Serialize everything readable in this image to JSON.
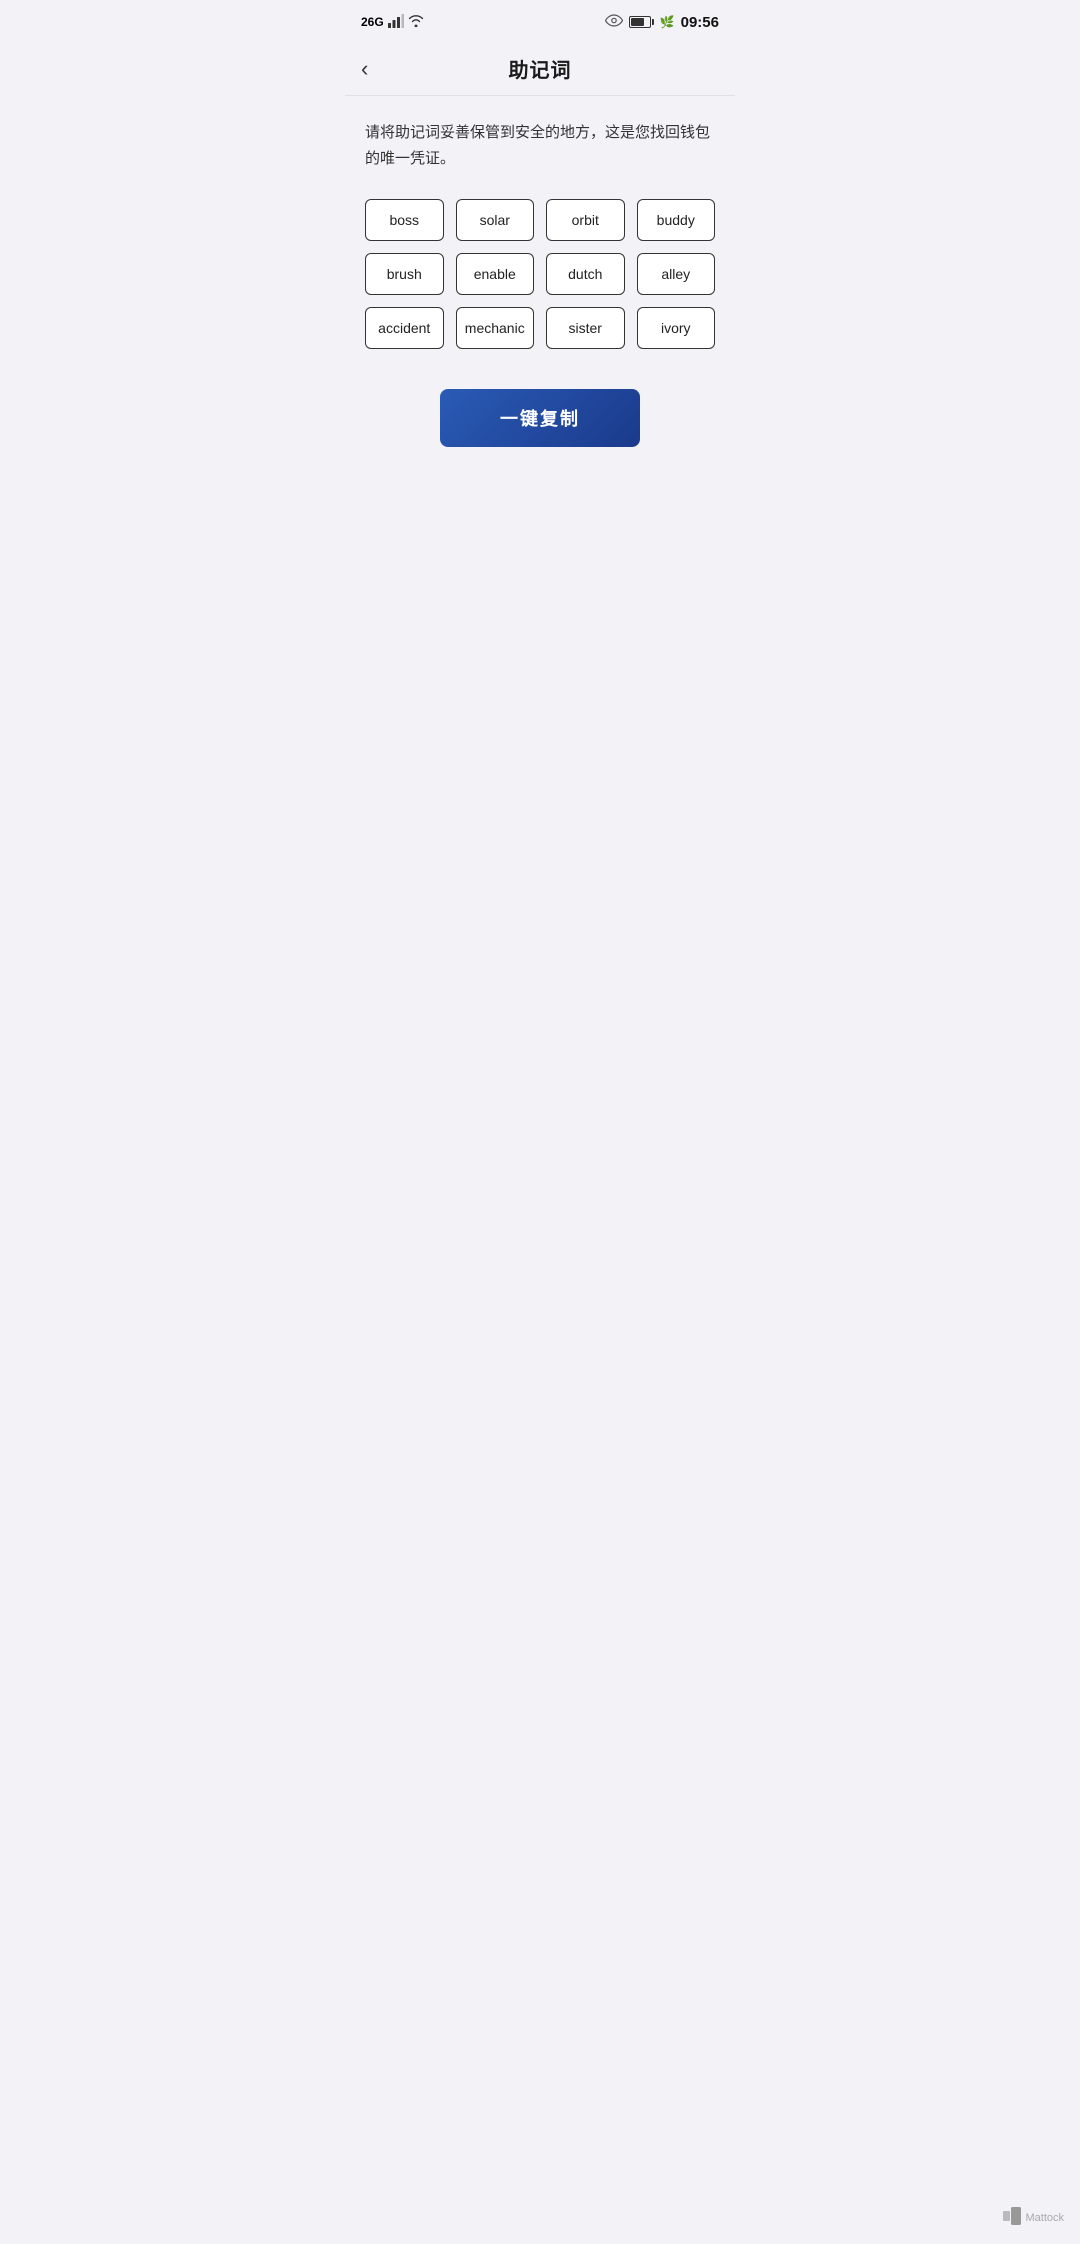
{
  "statusBar": {
    "network": "26",
    "time": "09:56"
  },
  "header": {
    "title": "助记词",
    "backLabel": "‹"
  },
  "description": "请将助记词妥善保管到安全的地方，这是您找回钱包的唯一凭证。",
  "words": [
    {
      "id": 1,
      "text": "boss"
    },
    {
      "id": 2,
      "text": "solar"
    },
    {
      "id": 3,
      "text": "orbit"
    },
    {
      "id": 4,
      "text": "buddy"
    },
    {
      "id": 5,
      "text": "brush"
    },
    {
      "id": 6,
      "text": "enable"
    },
    {
      "id": 7,
      "text": "dutch"
    },
    {
      "id": 8,
      "text": "alley"
    },
    {
      "id": 9,
      "text": "accident"
    },
    {
      "id": 10,
      "text": "mechanic"
    },
    {
      "id": 11,
      "text": "sister"
    },
    {
      "id": 12,
      "text": "ivory"
    }
  ],
  "copyButton": {
    "label": "一键复制"
  },
  "watermark": {
    "text": "Mattock"
  }
}
